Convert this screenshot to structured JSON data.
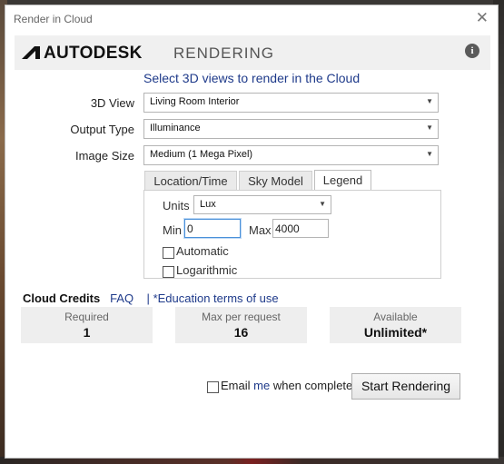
{
  "window": {
    "title": "Render in Cloud",
    "close_icon": "close-icon"
  },
  "brand": {
    "logo": "AUTODESK",
    "product": "RENDERING",
    "info_icon": "info-icon"
  },
  "heading": "Select 3D views to render in the Cloud",
  "form": {
    "view": {
      "label": "3D View",
      "value": "Living Room Interior"
    },
    "output": {
      "label": "Output Type",
      "value": "Illuminance"
    },
    "size": {
      "label": "Image Size",
      "value": "Medium (1 Mega Pixel)"
    }
  },
  "tabs": [
    {
      "label": "Location/Time",
      "active": false
    },
    {
      "label": "Sky Model",
      "active": false
    },
    {
      "label": "Legend",
      "active": true
    }
  ],
  "legend": {
    "units_label": "Units",
    "units_value": "Lux",
    "min_label": "Min",
    "min_value": "0",
    "max_label": "Max",
    "max_value": "4000",
    "automatic_label": "Automatic",
    "automatic_checked": false,
    "log_label": "Logarithmic",
    "log_checked": false
  },
  "credits": {
    "title": "Cloud Credits",
    "faq": "FAQ",
    "separator": "|",
    "education": "*Education terms of use"
  },
  "stats": [
    {
      "label": "Required",
      "value": "1"
    },
    {
      "label": "Max per request",
      "value": "16"
    },
    {
      "label": "Available",
      "value": "Unlimited*"
    }
  ],
  "footer": {
    "email_before": "Email",
    "email_me": "me",
    "email_after": "when complete",
    "email_checked": false,
    "start_button": "Start Rendering"
  },
  "colors": {
    "link": "#1e3a8a",
    "focus": "#4a90d9"
  }
}
